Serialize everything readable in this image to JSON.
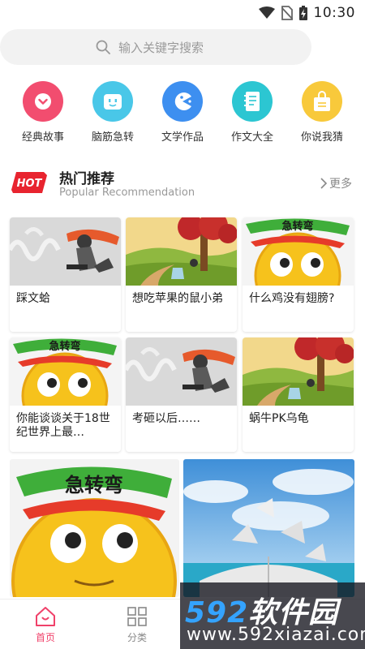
{
  "status_bar": {
    "time": "10:30"
  },
  "search": {
    "placeholder": "输入关键字搜索"
  },
  "categories": [
    {
      "label": "经典故事",
      "color": "#f24d6f",
      "icon": "chevron-down-icon"
    },
    {
      "label": "脑筋急转",
      "color": "#49c7e8",
      "icon": "robot-face-icon"
    },
    {
      "label": "文学作品",
      "color": "#3d8ff0",
      "icon": "pacman-icon"
    },
    {
      "label": "作文大全",
      "color": "#2cc6d2",
      "icon": "notebook-icon"
    },
    {
      "label": "你说我猜",
      "color": "#f8c93b",
      "icon": "bag-icon"
    }
  ],
  "section": {
    "badge": "HOT",
    "title": "热门推荐",
    "subtitle": "Popular Recommendation",
    "more": "更多"
  },
  "cards": [
    {
      "title": "踩文蛤"
    },
    {
      "title": "想吃苹果的鼠小弟"
    },
    {
      "title": "什么鸡没有翅膀?"
    },
    {
      "title": "你能谈谈关于18世纪世界上最…"
    },
    {
      "title": "考砸以后……"
    },
    {
      "title": "蜗牛PK乌龟"
    }
  ],
  "tile_text": "急转弯",
  "nav": {
    "home": "首页",
    "category": "分类",
    "active_color": "#f0416a"
  },
  "watermark": {
    "brand_num": "592",
    "brand_cn": "软件园",
    "domain": "www.592xiazai.com"
  }
}
